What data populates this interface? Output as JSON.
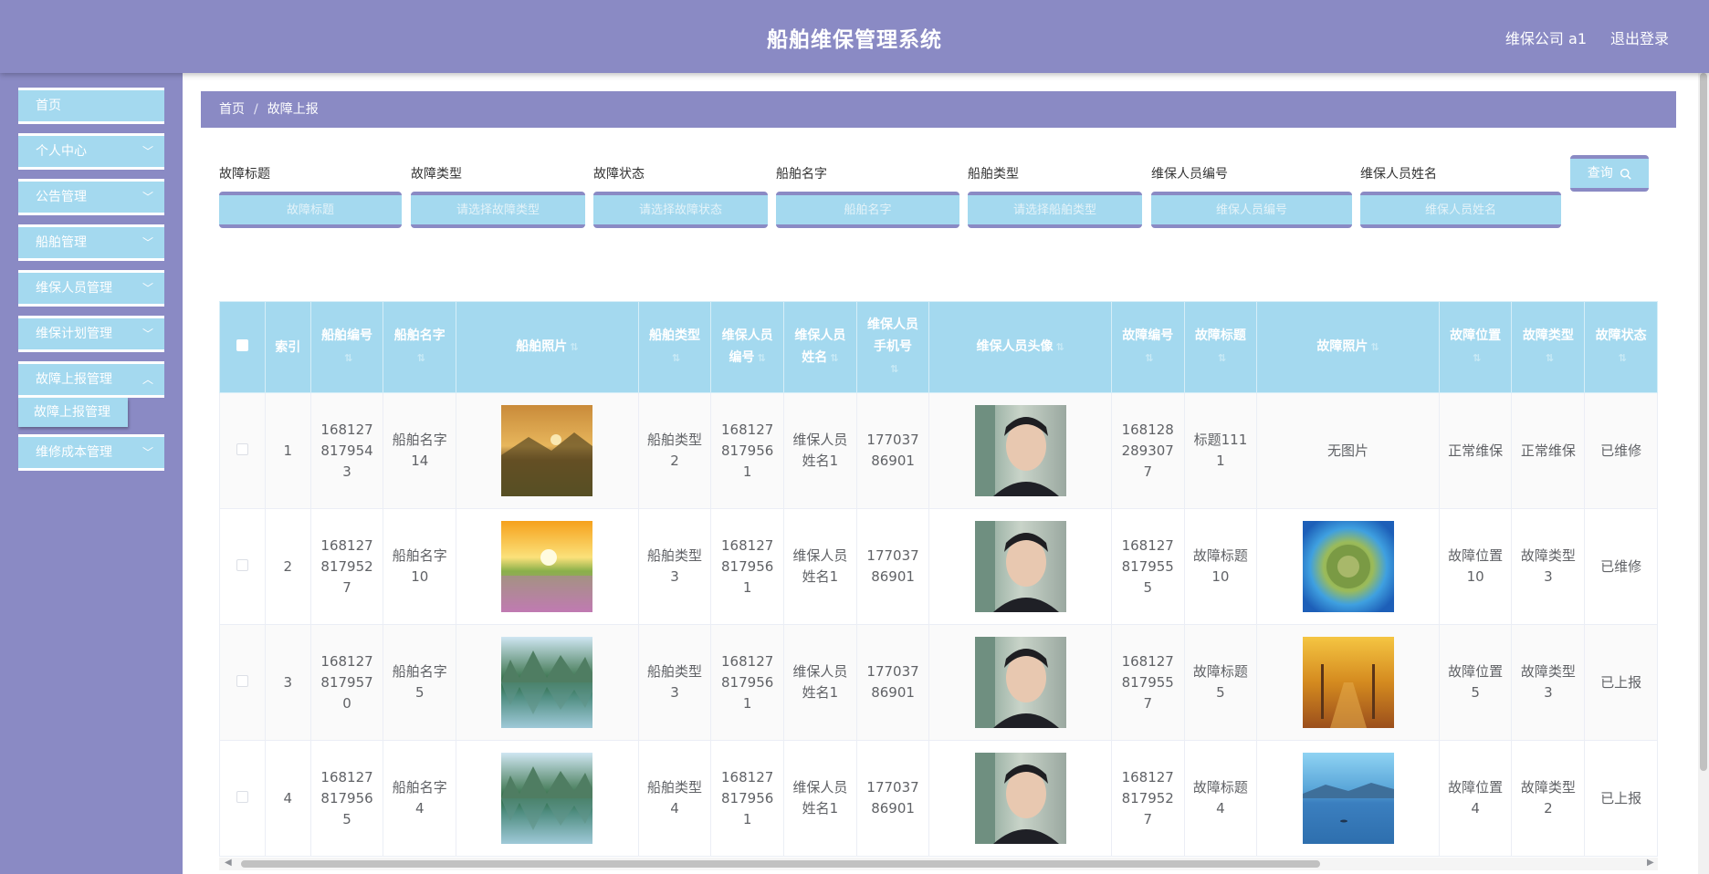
{
  "header": {
    "title": "船舶维保管理系统",
    "user": "维保公司 a1",
    "logout": "退出登录"
  },
  "sidebar": {
    "items": [
      {
        "label": "首页",
        "has_children": false
      },
      {
        "label": "个人中心",
        "has_children": true
      },
      {
        "label": "公告管理",
        "has_children": true
      },
      {
        "label": "船舶管理",
        "has_children": true
      },
      {
        "label": "维保人员管理",
        "has_children": true
      },
      {
        "label": "维保计划管理",
        "has_children": true
      },
      {
        "label": "故障上报管理",
        "has_children": true
      },
      {
        "label": "维修成本管理",
        "has_children": true
      }
    ],
    "submenu": {
      "label": "故障上报管理"
    }
  },
  "breadcrumb": {
    "home": "首页",
    "separator": "/",
    "current": "故障上报"
  },
  "search": {
    "fields": [
      {
        "label": "故障标题",
        "placeholder": "故障标题"
      },
      {
        "label": "故障类型",
        "placeholder": "请选择故障类型"
      },
      {
        "label": "故障状态",
        "placeholder": "请选择故障状态"
      },
      {
        "label": "船舶名字",
        "placeholder": "船舶名字"
      },
      {
        "label": "船舶类型",
        "placeholder": "请选择船舶类型"
      },
      {
        "label": "维保人员编号",
        "placeholder": "维保人员编号"
      },
      {
        "label": "维保人员姓名",
        "placeholder": "维保人员姓名"
      }
    ],
    "button_label": "查询",
    "search_icon": "search-icon"
  },
  "table": {
    "headers": [
      "索引",
      "船舶编号",
      "船舶名字",
      "船舶照片",
      "船舶类型",
      "维保人员编号",
      "维保人员姓名",
      "维保人员手机号",
      "维保人员头像",
      "故障编号",
      "故障标题",
      "故障照片",
      "故障位置",
      "故障类型",
      "故障状态"
    ],
    "rows": [
      {
        "index": "1",
        "ship_no": "1681278179543",
        "ship_name": "船舶名字14",
        "ship_photo": "mountain-sunset",
        "ship_type": "船舶类型2",
        "staff_no": "1681278179561",
        "staff_name": "维保人员姓名1",
        "staff_phone": "17703786901",
        "staff_avatar": "man-portrait",
        "fault_no": "1681282893077",
        "fault_title": "标题1111",
        "fault_photo": "无图片",
        "fault_location": "正常维保",
        "fault_type": "正常维保",
        "fault_status": "已维修"
      },
      {
        "index": "2",
        "ship_no": "1681278179527",
        "ship_name": "船舶名字10",
        "ship_photo": "sunset-meadow",
        "ship_type": "船舶类型3",
        "staff_no": "1681278179561",
        "staff_name": "维保人员姓名1",
        "staff_phone": "17703786901",
        "staff_avatar": "man-portrait",
        "fault_no": "1681278179555",
        "fault_title": "故障标题10",
        "fault_photo": "tiny-planet",
        "fault_location": "故障位置10",
        "fault_type": "故障类型3",
        "fault_status": "已维修"
      },
      {
        "index": "3",
        "ship_no": "1681278179570",
        "ship_name": "船舶名字5",
        "ship_photo": "lake-mountains",
        "ship_type": "船舶类型3",
        "staff_no": "1681278179561",
        "staff_name": "维保人员姓名1",
        "staff_phone": "17703786901",
        "staff_avatar": "man-portrait",
        "fault_no": "1681278179557",
        "fault_title": "故障标题5",
        "fault_photo": "autumn-trees",
        "fault_location": "故障位置5",
        "fault_type": "故障类型3",
        "fault_status": "已上报"
      },
      {
        "index": "4",
        "ship_no": "1681278179565",
        "ship_name": "船舶名字4",
        "ship_photo": "lake-mountains",
        "ship_type": "船舶类型4",
        "staff_no": "1681278179561",
        "staff_name": "维保人员姓名1",
        "staff_phone": "17703786901",
        "staff_avatar": "man-portrait",
        "fault_no": "1681278179527",
        "fault_title": "故障标题4",
        "fault_photo": "blue-lake",
        "fault_location": "故障位置4",
        "fault_type": "故障类型2",
        "fault_status": "已上报"
      }
    ]
  },
  "colors": {
    "primary": "#8a8ac4",
    "accent": "#a4d9ef",
    "text": "#606266"
  }
}
